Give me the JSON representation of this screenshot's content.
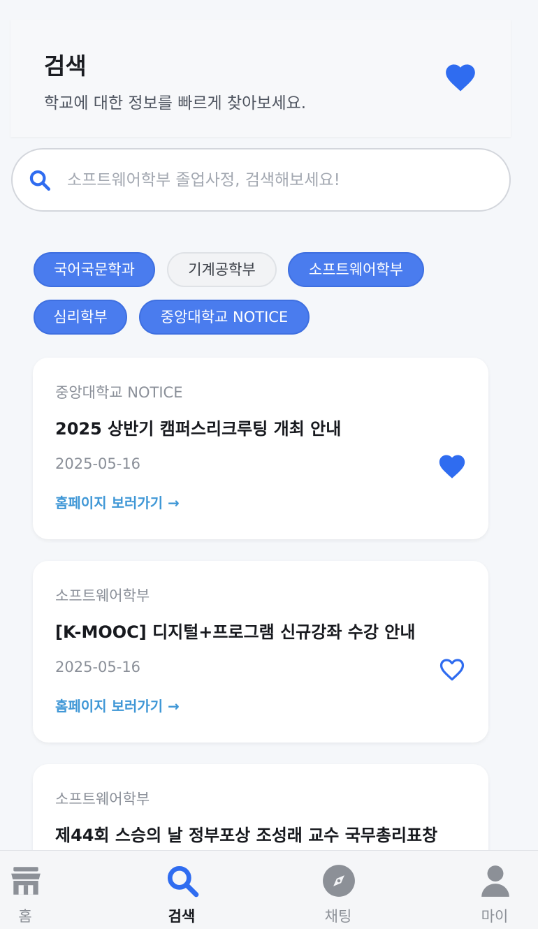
{
  "header": {
    "title": "검색",
    "subtitle": "학교에 대한 정보를 빠르게 찾아보세요.",
    "heart_icon": "heart-filled"
  },
  "search": {
    "placeholder": "소프트웨어학부 졸업사정, 검색해보세요!",
    "value": "",
    "icon": "search-icon"
  },
  "chips": [
    {
      "label": "국어국문학과",
      "active": true
    },
    {
      "label": "기계공학부",
      "active": false
    },
    {
      "label": "소프트웨어학부",
      "active": true
    },
    {
      "label": "심리학부",
      "active": true
    },
    {
      "label": "중앙대학교 NOTICE",
      "active": true
    }
  ],
  "cards": [
    {
      "source": "중앙대학교 NOTICE",
      "title": "2025 상반기 캠퍼스리크루팅 개최 안내",
      "date": "2025-05-16",
      "link": "홈페이지 보러가기 →",
      "favorited": true
    },
    {
      "source": "소프트웨어학부",
      "title": "[K-MOOC] 디지털+프로그램 신규강좌 수강 안내",
      "date": "2025-05-16",
      "link": "홈페이지 보러가기 →",
      "favorited": false
    },
    {
      "source": "소프트웨어학부",
      "title": "제44회 스승의 날 정부포상 조성래 교수 국무총리표창",
      "date": "",
      "link": "",
      "favorited": false
    }
  ],
  "nav": [
    {
      "label": "홈",
      "icon": "store-icon",
      "active": false
    },
    {
      "label": "검색",
      "icon": "search-icon",
      "active": true
    },
    {
      "label": "채팅",
      "icon": "compass-icon",
      "active": false
    },
    {
      "label": "마이",
      "icon": "person-icon",
      "active": false
    }
  ],
  "colors": {
    "accent": "#2f6cf0",
    "chip_active": "#4a7cee",
    "link": "#3f97d6",
    "background": "#f5f7fa"
  }
}
